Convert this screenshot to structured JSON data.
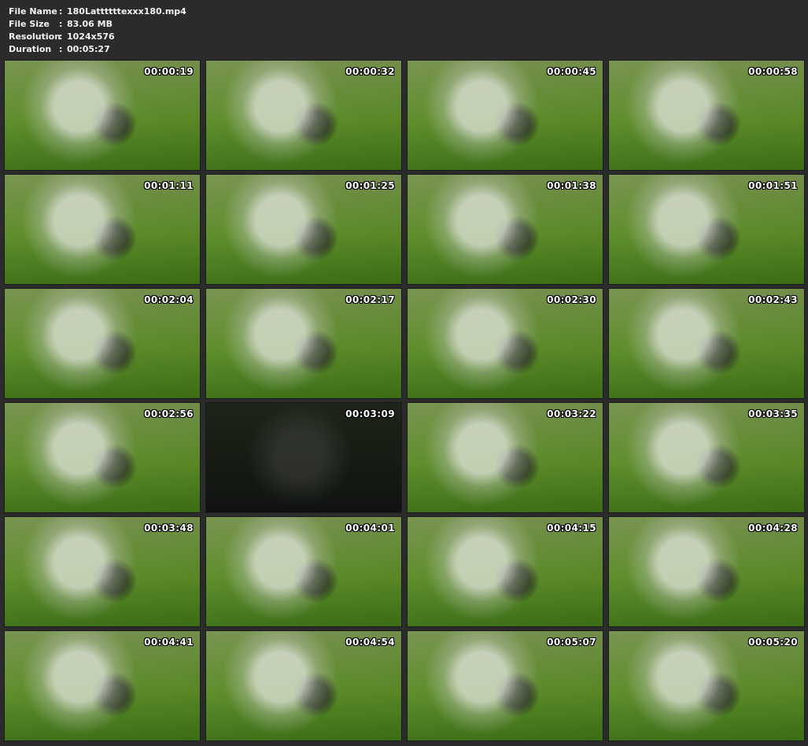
{
  "file_info": {
    "file_name_label": "File Name",
    "file_name_value": "180Lattttttexxx180.mp4",
    "file_size_label": "File Size",
    "file_size_value": "83.06 MB",
    "resolution_label": "Resolution",
    "resolution_value": "1024x576",
    "duration_label": "Duration",
    "duration_value": "00:05:27",
    "separator": ":"
  },
  "thumbnails": [
    {
      "timestamp": "00:00:19",
      "icon": "video-frame-icon"
    },
    {
      "timestamp": "00:00:32",
      "icon": "video-frame-icon"
    },
    {
      "timestamp": "00:00:45",
      "icon": "video-frame-icon"
    },
    {
      "timestamp": "00:00:58",
      "icon": "video-frame-icon"
    },
    {
      "timestamp": "00:01:11",
      "icon": "video-frame-icon"
    },
    {
      "timestamp": "00:01:25",
      "icon": "video-frame-icon"
    },
    {
      "timestamp": "00:01:38",
      "icon": "video-frame-icon"
    },
    {
      "timestamp": "00:01:51",
      "icon": "video-frame-icon"
    },
    {
      "timestamp": "00:02:04",
      "icon": "video-frame-icon"
    },
    {
      "timestamp": "00:02:17",
      "icon": "video-frame-icon"
    },
    {
      "timestamp": "00:02:30",
      "icon": "video-frame-icon"
    },
    {
      "timestamp": "00:02:43",
      "icon": "video-frame-icon"
    },
    {
      "timestamp": "00:02:56",
      "icon": "video-frame-icon"
    },
    {
      "timestamp": "00:03:09",
      "icon": "video-frame-icon"
    },
    {
      "timestamp": "00:03:22",
      "icon": "video-frame-icon"
    },
    {
      "timestamp": "00:03:35",
      "icon": "video-frame-icon"
    },
    {
      "timestamp": "00:03:48",
      "icon": "video-frame-icon"
    },
    {
      "timestamp": "00:04:01",
      "icon": "video-frame-icon"
    },
    {
      "timestamp": "00:04:15",
      "icon": "video-frame-icon"
    },
    {
      "timestamp": "00:04:28",
      "icon": "video-frame-icon"
    },
    {
      "timestamp": "00:04:41",
      "icon": "video-frame-icon"
    },
    {
      "timestamp": "00:04:54",
      "icon": "video-frame-icon"
    },
    {
      "timestamp": "00:05:07",
      "icon": "video-frame-icon"
    },
    {
      "timestamp": "00:05:20",
      "icon": "video-frame-icon"
    }
  ],
  "colors": {
    "background": "#2b2b2b",
    "text": "#f2f2f2",
    "timestamp_text": "#ffffff"
  }
}
